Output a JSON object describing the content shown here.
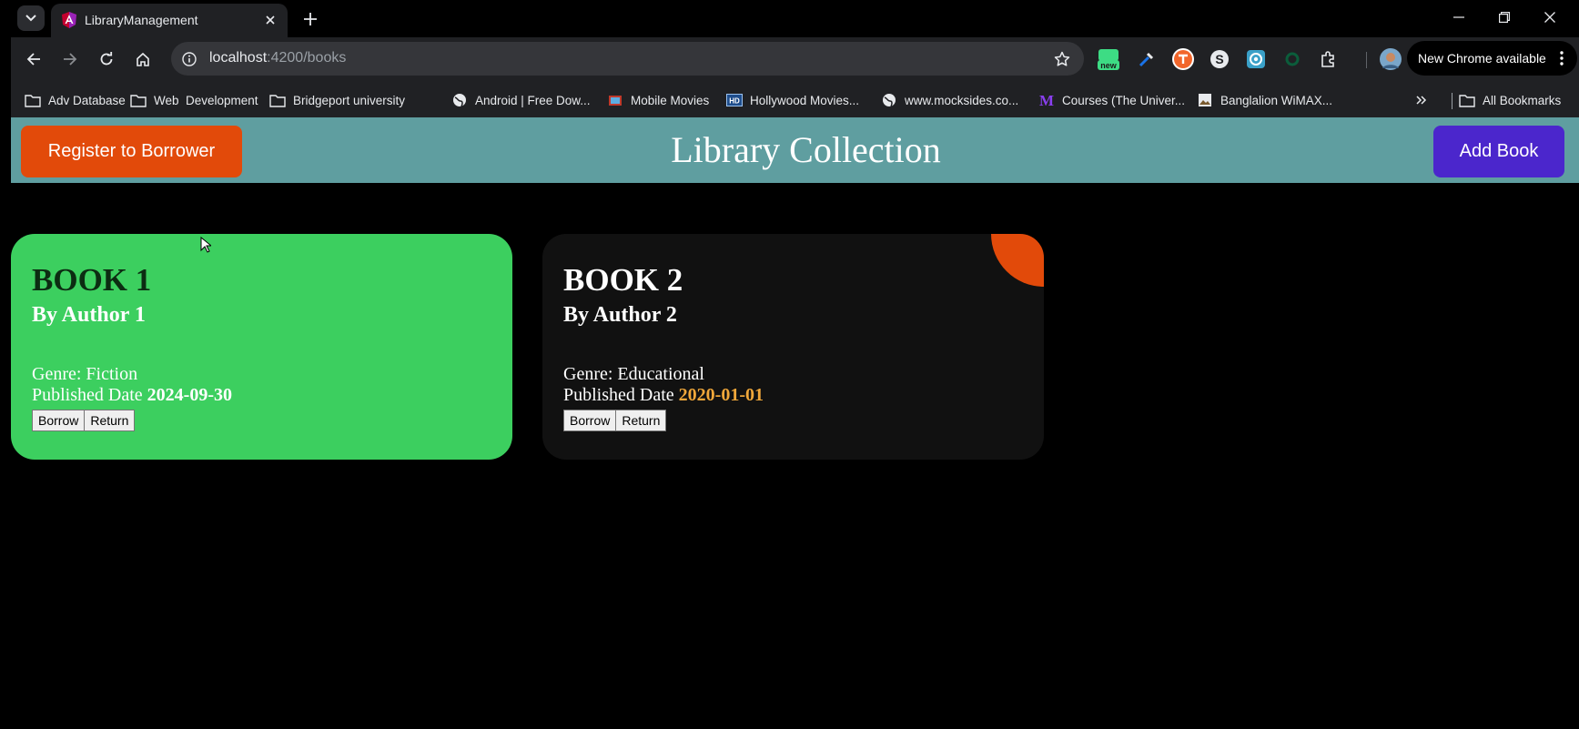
{
  "browser": {
    "tab_title": "LibraryManagement",
    "url_host": "localhost",
    "url_path": ":4200/books",
    "extension_badge": "new",
    "update_label": "New Chrome available",
    "bookmarks": [
      {
        "label": "Adv Database",
        "icon": "folder-icon"
      },
      {
        "label": "Web  Development",
        "icon": "folder-icon"
      },
      {
        "label": "Bridgeport university",
        "icon": "folder-icon"
      },
      {
        "label": "Android | Free Dow...",
        "icon": "globe-icon"
      },
      {
        "label": "Mobile Movies",
        "icon": "site-icon"
      },
      {
        "label": "Hollywood Movies...",
        "icon": "hd-icon"
      },
      {
        "label": "www.mocksides.co...",
        "icon": "globe-icon"
      },
      {
        "label": "Courses (The Univer...",
        "icon": "m-icon"
      },
      {
        "label": "Banglalion WiMAX...",
        "icon": "image-icon"
      }
    ],
    "all_bookmarks_label": "All Bookmarks"
  },
  "app": {
    "register_label": "Register to Borrower",
    "title": "Library Collection",
    "add_label": "Add Book"
  },
  "books": [
    {
      "title": "BOOK 1",
      "author": "By Author 1",
      "genre": "Genre: Fiction",
      "date_label": "Published Date",
      "date": "2024-09-30",
      "borrow_label": "Borrow",
      "return_label": "Return"
    },
    {
      "title": "BOOK 2",
      "author": "By Author 2",
      "genre": "Genre: Educational",
      "date_label": "Published Date",
      "date": "2020-01-01",
      "borrow_label": "Borrow",
      "return_label": "Return"
    }
  ],
  "colors": {
    "header_bg": "#5f9ea0",
    "register_bg": "#e24a0a",
    "add_bg": "#4b26cc",
    "card1_bg": "#3ccf5f",
    "card2_bg": "#111111",
    "date_accent": "#f0a73a"
  }
}
